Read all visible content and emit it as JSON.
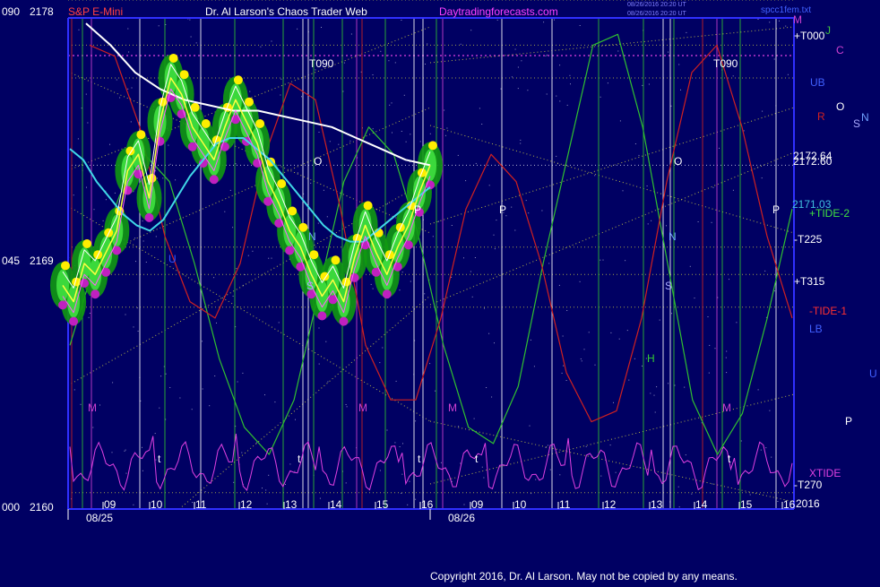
{
  "header": {
    "left_code": "090",
    "left_price": "2178",
    "instrument": "S&P E-Mini",
    "title": "Dr. Al Larson's Chaos Trader Web",
    "site": "Daytradingforecasts.com",
    "stamp1": "08/26/2016 20:20 UT",
    "stamp2": "08/26/2016 20:20 UT",
    "file": "spcc1fem.txt"
  },
  "left_axis": [
    {
      "code": "090",
      "price": "2178"
    },
    {
      "code": "045",
      "price": "2169"
    },
    {
      "code": "000",
      "price": "2160"
    }
  ],
  "right_labels": {
    "m": "M",
    "j": "J",
    "c": "C",
    "t000": "+T000",
    "ub": "UB",
    "o": "O",
    "r": "R",
    "s": "S",
    "n": "N",
    "price1": "2172.64",
    "price2": "2172.60",
    "price3": "2171.03",
    "tide2": "+TIDE-2",
    "t225": "-T225",
    "t315": "+T315",
    "tide1": "-TIDE-1",
    "lb": "LB",
    "u": "U",
    "p": "P",
    "xtide": "XTIDE",
    "t270": "-T270",
    "year": "2016"
  },
  "chart_markers": [
    {
      "text": "T090",
      "color": "#ffffff"
    },
    {
      "text": "T090",
      "color": "#ffffff"
    },
    {
      "text": "O",
      "color": "#ffffff"
    },
    {
      "text": "O",
      "color": "#ffffff"
    },
    {
      "text": "P",
      "color": "#ffffff"
    },
    {
      "text": "P",
      "color": "#ffffff"
    },
    {
      "text": "P",
      "color": "#ffffff"
    },
    {
      "text": "N",
      "color": "#6fa0ff"
    },
    {
      "text": "N",
      "color": "#6fa0ff"
    },
    {
      "text": "S",
      "color": "#aaaaff"
    },
    {
      "text": "S",
      "color": "#aaaaff"
    },
    {
      "text": "U",
      "color": "#3355ff"
    },
    {
      "text": "H",
      "color": "#33cc33"
    },
    {
      "text": "M",
      "color": "#d040d0"
    },
    {
      "text": "M",
      "color": "#d040d0"
    },
    {
      "text": "M",
      "color": "#d040d0"
    },
    {
      "text": "M",
      "color": "#d040d0"
    },
    {
      "text": "t",
      "color": "#ffffff"
    },
    {
      "text": "t",
      "color": "#ffffff"
    },
    {
      "text": "t",
      "color": "#ffffff"
    },
    {
      "text": "t",
      "color": "#ffffff"
    },
    {
      "text": "t",
      "color": "#ffffff"
    }
  ],
  "footer": {
    "date1": "08/25",
    "date2": "08/26",
    "copyright": "Copyright 2016, Dr. Al Larson. May not be copied by any means."
  },
  "chart_data": {
    "type": "line",
    "ylim": [
      2160,
      2178
    ],
    "x_hours": [
      "09",
      "10",
      "11",
      "12",
      "13",
      "14",
      "15",
      "16",
      "09",
      "10",
      "11",
      "12",
      "13",
      "14",
      "15",
      "16"
    ],
    "x_dates": [
      "08/25",
      "08/26"
    ],
    "price_series": [
      2168.2,
      2167.6,
      2169.0,
      2168.6,
      2169.4,
      2170.2,
      2172.4,
      2173.0,
      2171.4,
      2174.2,
      2175.8,
      2175.2,
      2174.0,
      2173.4,
      2172.8,
      2174.0,
      2175.0,
      2174.2,
      2173.4,
      2172.0,
      2171.2,
      2170.2,
      2169.6,
      2168.6,
      2167.8,
      2168.4,
      2167.6,
      2169.2,
      2170.4,
      2169.4,
      2168.6,
      2169.6,
      2170.4,
      2171.6,
      2172.6
    ],
    "moving_avg_cyan": [
      2173.2,
      2172.8,
      2172.0,
      2171.4,
      2170.8,
      2170.4,
      2170.2,
      2170.6,
      2171.4,
      2172.2,
      2172.8,
      2173.4,
      2173.6,
      2173.6,
      2173.2,
      2172.8,
      2172.2,
      2171.6,
      2171.0,
      2170.4,
      2170.0,
      2169.8,
      2169.8,
      2170.2,
      2170.6,
      2171.0,
      2171.4,
      2171.8
    ],
    "moving_avg_white": [
      2177.8,
      2177.0,
      2176.0,
      2175.4,
      2175.0,
      2174.8,
      2174.6,
      2174.6,
      2174.4,
      2174.2,
      2174.0,
      2173.6,
      2173.2,
      2172.8,
      2172.6
    ],
    "forecast_green": [
      2166.0,
      2169.0,
      2171.5,
      2173.0,
      2172.0,
      2169.0,
      2165.5,
      2163.0,
      2162.0,
      2164.0,
      2168.0,
      2172.0,
      2174.0,
      2173.0,
      2170.0,
      2166.0,
      2163.0,
      2162.4,
      2164.5,
      2169.0,
      2173.0,
      2177.0,
      2177.4,
      2174.0,
      2169.0,
      2164.0,
      2162.0,
      2163.5,
      2167.0,
      2171.0
    ],
    "forecast_red": [
      2177.0,
      2176.6,
      2174.0,
      2170.0,
      2167.6,
      2167.0,
      2169.0,
      2173.0,
      2175.6,
      2175.0,
      2171.0,
      2166.0,
      2164.0,
      2164.0,
      2167.0,
      2171.0,
      2173.0,
      2172.0,
      2169.0,
      2165.0,
      2163.2,
      2163.6,
      2167.0,
      2172.0,
      2176.0,
      2177.0,
      2174.0,
      2170.0,
      2167.0
    ],
    "price_levels": {
      "T000": 2177.0,
      "UB": 2175.8,
      "current_high": 2172.64,
      "current": 2172.6,
      "ma_value": 2171.03,
      "T225": 2169.6,
      "T315": 2168.6,
      "TIDE-1": 2167.8,
      "LB": 2167.4,
      "T270": 2160.6
    }
  }
}
